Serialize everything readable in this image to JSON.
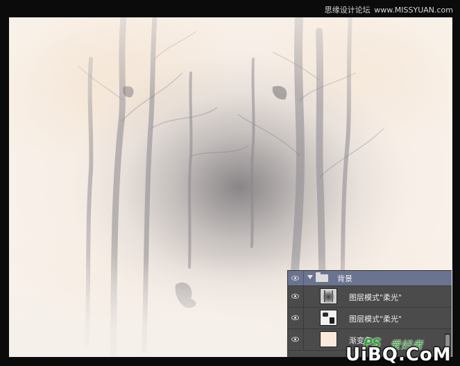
{
  "header": {
    "watermark_left": "思缘设计论坛",
    "watermark_sep": "www.MISSYUAN.com"
  },
  "layers_panel": {
    "group": {
      "label": "背景",
      "visible": true,
      "expanded": true
    },
    "layers": [
      {
        "label": "图层模式\"柔光\"",
        "thumbnail": "forest-photo",
        "visible": true
      },
      {
        "label": "图层模式\"柔光\"",
        "thumbnail": "black-white-mask",
        "visible": true
      },
      {
        "label": "渐变色",
        "thumbnail": "color-fill",
        "thumbnail_color": "#fbeadc",
        "visible": true
      }
    ]
  },
  "logos": {
    "ps_mark": "PS",
    "ps_cn": "爱好者",
    "site": "UiBQ.CoM"
  },
  "colors": {
    "background": "#0b0b0b",
    "panel": "#4b4b4b",
    "group_highlight": "#6a738f",
    "logo_green": "#2fa33a"
  }
}
